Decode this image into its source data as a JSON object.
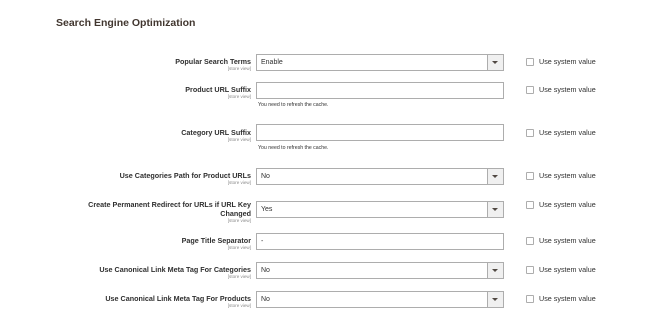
{
  "section": {
    "title": "Search Engine Optimization"
  },
  "system_value_label": "Use system value",
  "fields": {
    "popular_search_terms": {
      "label": "Popular Search Terms",
      "scope": "[store view]",
      "value": "Enable"
    },
    "product_url_suffix": {
      "label": "Product URL Suffix",
      "scope": "[store view]",
      "value": "",
      "note": "You need to refresh the cache."
    },
    "category_url_suffix": {
      "label": "Category URL Suffix",
      "scope": "[store view]",
      "value": "",
      "note": "You need to refresh the cache."
    },
    "use_categories_path": {
      "label": "Use Categories Path for Product URLs",
      "scope": "[store view]",
      "value": "No"
    },
    "permanent_redirect": {
      "label_line1": "Create Permanent Redirect for URLs if URL Key",
      "label_line2": "Changed",
      "scope": "[store view]",
      "value": "Yes"
    },
    "page_title_separator": {
      "label": "Page Title Separator",
      "scope": "[store view]",
      "value": "-"
    },
    "canonical_categories": {
      "label": "Use Canonical Link Meta Tag For Categories",
      "scope": "[store view]",
      "value": "No"
    },
    "canonical_products": {
      "label": "Use Canonical Link Meta Tag For Products",
      "scope": "[store view]",
      "value": "No"
    }
  }
}
